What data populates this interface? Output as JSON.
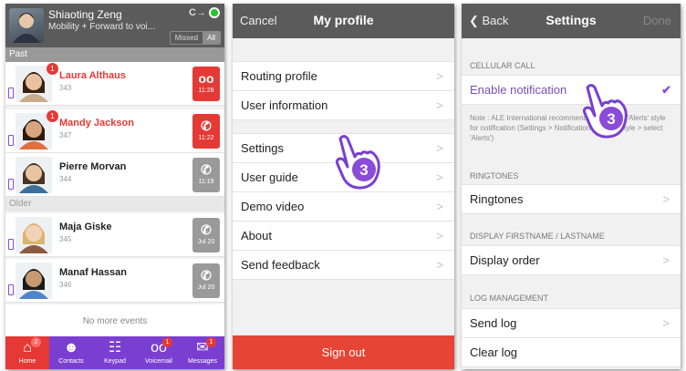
{
  "p1": {
    "header": {
      "name": "Shiaoting Zeng",
      "status": "Mobility + Forward to voi...",
      "forward_icon": "C→",
      "filter_missed": "Missed",
      "filter_all": "All"
    },
    "section_past": "Past",
    "section_older": "Older",
    "calls": [
      {
        "name": "Laura Althaus",
        "number": "343",
        "badge": "1",
        "action_icon": "voicemail-icon",
        "action_glyph": "οο",
        "time": "11:28",
        "missed": true
      },
      {
        "name": "Mandy Jackson",
        "number": "347",
        "badge": "1",
        "action_icon": "phone-icon",
        "action_glyph": "✆",
        "time": "11:22",
        "missed": true
      },
      {
        "name": "Pierre Morvan",
        "number": "344",
        "badge": "",
        "action_icon": "phone-icon",
        "action_glyph": "✆",
        "time": "11:19",
        "missed": false
      },
      {
        "name": "Maja Giske",
        "number": "345",
        "badge": "",
        "action_icon": "phone-icon",
        "action_glyph": "✆",
        "time": "Jul 20",
        "missed": false
      },
      {
        "name": "Manaf Hassan",
        "number": "346",
        "badge": "",
        "action_icon": "phone-icon",
        "action_glyph": "✆",
        "time": "Jul 20",
        "missed": false
      }
    ],
    "no_more": "No more events",
    "tabs": [
      {
        "label": "Home",
        "icon": "home-icon",
        "glyph": "⌂",
        "badge": "2"
      },
      {
        "label": "Contacts",
        "icon": "contacts-icon",
        "glyph": "☻",
        "badge": ""
      },
      {
        "label": "Keypad",
        "icon": "keypad-icon",
        "glyph": "☷",
        "badge": ""
      },
      {
        "label": "Voicemail",
        "icon": "voicemail-icon",
        "glyph": "οο",
        "badge": "1"
      },
      {
        "label": "Messages",
        "icon": "messages-icon",
        "glyph": "✉",
        "badge": "1"
      }
    ]
  },
  "p2": {
    "nav": {
      "left": "Cancel",
      "title": "My profile"
    },
    "group1": [
      "Routing profile",
      "User information"
    ],
    "group2": [
      "Settings",
      "User guide",
      "Demo video",
      "About",
      "Send feedback"
    ],
    "sign_out": "Sign out",
    "hand_number": "3"
  },
  "p3": {
    "nav": {
      "left": "❮ Back",
      "title": "Settings",
      "right": "Done"
    },
    "sec_cellular": "CELLULAR CALL",
    "enable_notification": "Enable notification",
    "note": "Note : ALE International recommends to use the 'Alerts' style for notification (Settings > Notifications > Alert Style > select 'Alerts')",
    "sec_ringtones": "RINGTONES",
    "ringtones": "Ringtones",
    "sec_display": "DISPLAY FIRSTNAME / LASTNAME",
    "display_order": "Display order",
    "sec_log": "LOG MANAGEMENT",
    "send_log": "Send log",
    "clear_log": "Clear log",
    "hand_number": "3"
  },
  "colors": {
    "header": "#5b5b5b",
    "accent": "#8a4bd8",
    "missed": "#e53935",
    "signout": "#e64434",
    "tabbar": "#7a3fd1"
  }
}
